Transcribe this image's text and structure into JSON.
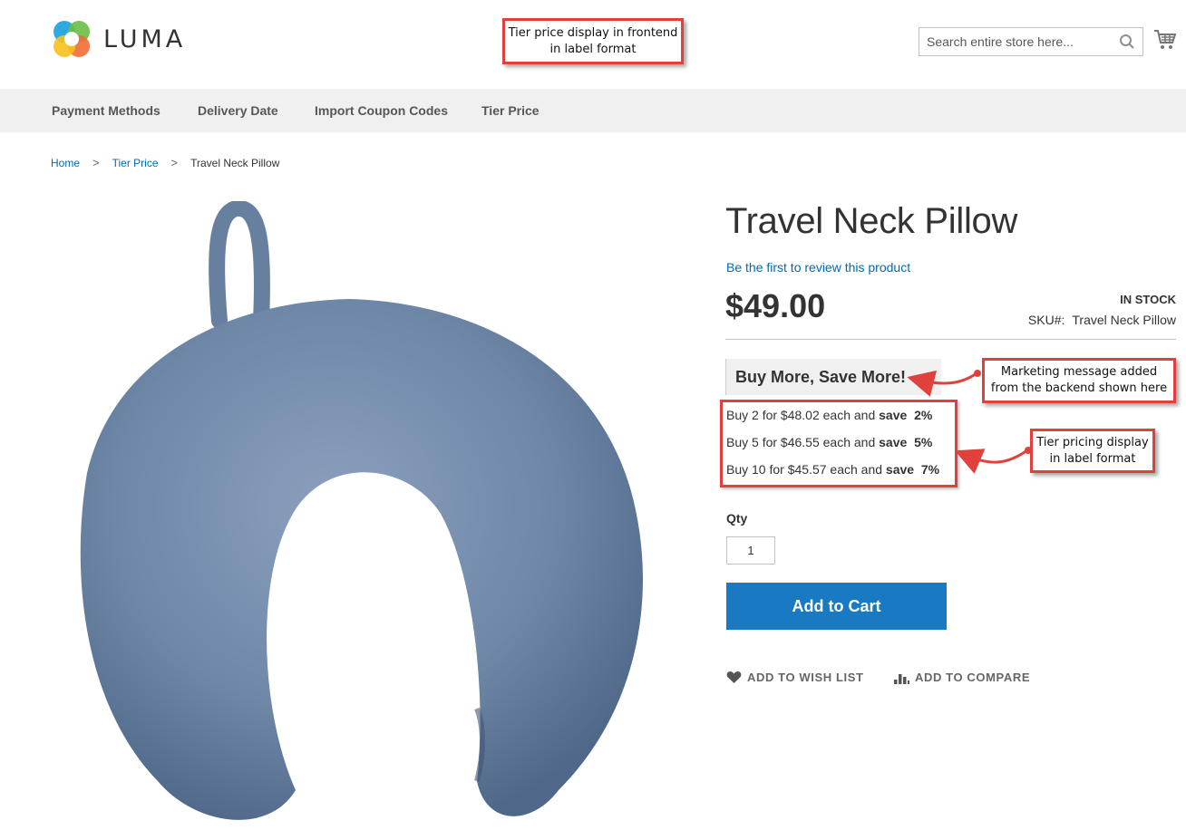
{
  "header": {
    "logo_text": "LUMA",
    "search_placeholder": "Search entire store here..."
  },
  "nav": {
    "items": [
      {
        "label": "Payment Methods"
      },
      {
        "label": "Delivery Date"
      },
      {
        "label": "Import Coupon Codes"
      },
      {
        "label": "Tier Price"
      }
    ]
  },
  "breadcrumb": {
    "items": [
      "Home",
      "Tier Price"
    ],
    "current": "Travel Neck Pillow",
    "separator": ">"
  },
  "product": {
    "title": "Travel Neck Pillow",
    "review_link": "Be the first to review this product",
    "price": "$49.00",
    "stock": "IN STOCK",
    "sku_label": "SKU#:",
    "sku_value": "Travel Neck Pillow",
    "marketing_message": "Buy More, Save More!",
    "tiers": [
      {
        "text": "Buy 2 for $48.02 each and ",
        "save_label": "save",
        "save_value": "2%"
      },
      {
        "text": "Buy 5 for $46.55 each and ",
        "save_label": "save",
        "save_value": "5%"
      },
      {
        "text": "Buy 10 for $45.57 each and ",
        "save_label": "save",
        "save_value": "7%"
      }
    ],
    "qty_label": "Qty",
    "qty_value": "1",
    "add_to_cart_label": "Add to Cart",
    "wishlist_label": "ADD TO WISH LIST",
    "compare_label": "ADD TO COMPARE"
  },
  "annotations": {
    "top": {
      "line1": "Tier price display in frontend",
      "line2": "in label format"
    },
    "marketing": {
      "line1": "Marketing message added",
      "line2": "from the backend shown here"
    },
    "tier": {
      "line1": "Tier pricing display",
      "line2": "in label format"
    }
  },
  "colors": {
    "accent": "#1979c3",
    "link": "#006bb4",
    "annotation": "#e0413d",
    "nav_bg": "#f0f0f0",
    "pillow": "#6f88a8"
  },
  "icons": [
    "luma-logo-icon",
    "search-icon",
    "cart-icon",
    "heart-icon",
    "compare-icon"
  ]
}
